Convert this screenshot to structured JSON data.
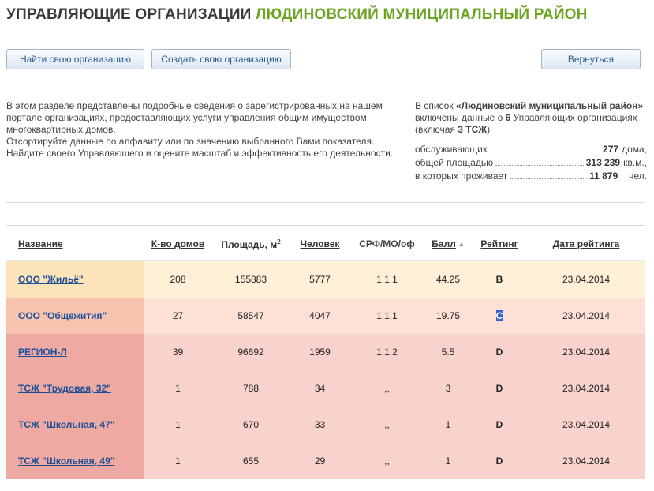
{
  "header": {
    "title_prefix": "УПРАВЛЯЮЩИЕ ОРГАНИЗАЦИИ",
    "title_region": "ЛЮДИНОВСКИЙ МУНИЦИПАЛЬНЫЙ РАЙОН"
  },
  "toolbar": {
    "find_label": "Найти свою организацию",
    "create_label": "Создать свою организацию",
    "back_label": "Вернуться"
  },
  "intro": {
    "line1": "В этом разделе представлены подробные сведения о зарегистрированных на нашем портале организациях, предоставляющих услуги управления общим имуществом многоквартирных домов.",
    "line2": "Отсортируйте данные по алфавиту или по значению выбранного Вами показателя.",
    "line3": "Найдите своего Управляющего и оцените масштаб и эффективность его деятельности."
  },
  "summary": {
    "text_a": "В список ",
    "region_quoted": "«Людиновский муниципальный район»",
    "text_b": " включены данные о ",
    "org_count": "6",
    "text_c": " Управляющих организациях (включая ",
    "tsj_count": "3 ТСЖ",
    "text_d": ")",
    "stats": [
      {
        "label": "обслуживающих",
        "value": "277",
        "unit": "дома,"
      },
      {
        "label": "общей площадью",
        "value": "313 239",
        "unit": "кв.м.,"
      },
      {
        "label": "в которых проживает",
        "value": "11 879",
        "unit": "чел."
      }
    ]
  },
  "table": {
    "headers": {
      "name": "Название",
      "houses": "К-во домов",
      "area": "Площадь, м",
      "area_sup": "2",
      "people": "Человек",
      "srf": "СРФ/МО/оф",
      "score": "Балл",
      "score_sort": "▲",
      "rating": "Рейтинг",
      "date": "Дата рейтинга"
    },
    "rows": [
      {
        "name": "ООО \"Жильё\"",
        "houses": "208",
        "area": "155883",
        "people": "5777",
        "srf": "1,1,1",
        "score": "44.25",
        "rating": "B",
        "date": "23.04.2014"
      },
      {
        "name": "ООО \"Общежития\"",
        "houses": "27",
        "area": "58547",
        "people": "4047",
        "srf": "1,1,1",
        "score": "19.75",
        "rating": "C",
        "date": "23.04.2014"
      },
      {
        "name": "РЕГИОН-Л",
        "houses": "39",
        "area": "96692",
        "people": "1959",
        "srf": "1,1,2",
        "score": "5.5",
        "rating": "D",
        "date": "23.04.2014"
      },
      {
        "name": "ТСЖ \"Трудовая, 32\"",
        "houses": "1",
        "area": "788",
        "people": "34",
        "srf": ",,",
        "score": "3",
        "rating": "D",
        "date": "23.04.2014"
      },
      {
        "name": "ТСЖ \"Школьная, 47\"",
        "houses": "1",
        "area": "670",
        "people": "33",
        "srf": ",,",
        "score": "1",
        "rating": "D",
        "date": "23.04.2014"
      },
      {
        "name": "ТСЖ \"Школьная, 49\"",
        "houses": "1",
        "area": "655",
        "people": "29",
        "srf": ",,",
        "score": "1",
        "rating": "D",
        "date": "23.04.2014"
      }
    ]
  },
  "colors": {
    "title_green": "#6aa421",
    "link_blue": "#1d4f98",
    "row_b_first": "#fde3b8",
    "row_b": "#fff1d8",
    "row_c_first": "#f8c4b0",
    "row_c": "#fde1d6",
    "row_d_first": "#eea9a2",
    "row_d": "#f8d2cd"
  }
}
